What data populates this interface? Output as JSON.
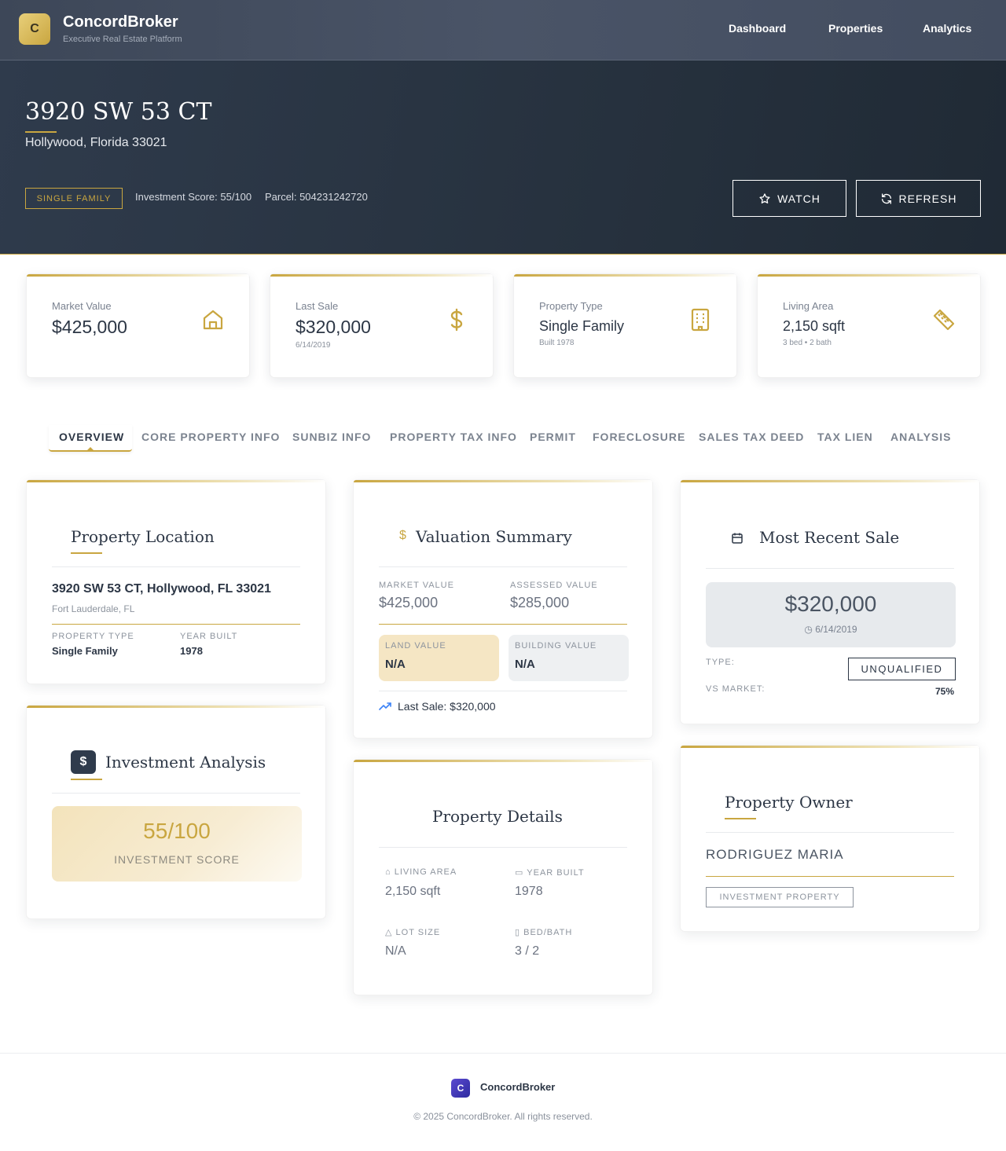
{
  "colors": {
    "accent": "#c9a640",
    "navy": "#2c3645",
    "hero": "#27323f"
  },
  "brand": {
    "logo_letter": "C",
    "name": "ConcordBroker",
    "tagline": "Executive Real Estate Platform"
  },
  "nav": {
    "items": [
      "Dashboard",
      "Properties",
      "Analytics"
    ]
  },
  "hero": {
    "address": "3920 SW 53 CT",
    "city_line": "Hollywood, Florida 33021",
    "badge": "SINGLE FAMILY",
    "investment_score": "Investment Score: 55/100",
    "parcel": "Parcel: 504231242720",
    "watch_label": "WATCH",
    "refresh_label": "REFRESH"
  },
  "stats": [
    {
      "label": "Market Value",
      "value": "$425,000",
      "sub": "",
      "icon": "home-icon"
    },
    {
      "label": "Last Sale",
      "value": "$320,000",
      "sub": "6/14/2019",
      "icon": "dollar-icon"
    },
    {
      "label": "Property Type",
      "value": "Single Family",
      "sub": "Built 1978",
      "icon": "building-icon"
    },
    {
      "label": "Living Area",
      "value": "2,150 sqft",
      "sub": "3 bed • 2 bath",
      "icon": "ruler-icon"
    }
  ],
  "tabs": [
    "OVERVIEW",
    "CORE PROPERTY INFO",
    "SUNBIZ INFO",
    "PROPERTY TAX INFO",
    "PERMIT",
    "FORECLOSURE",
    "SALES TAX DEED",
    "TAX LIEN",
    "ANALYSIS"
  ],
  "location": {
    "title": "Property Location",
    "full_address": "3920 SW 53 CT, Hollywood, FL 33021",
    "area": "Fort Lauderdale, FL",
    "type_label": "PROPERTY TYPE",
    "type_value": "Single Family",
    "year_label": "YEAR BUILT",
    "year_value": "1978"
  },
  "valuation": {
    "title": "Valuation Summary",
    "market_label": "MARKET VALUE",
    "market_value": "$425,000",
    "assessed_label": "ASSESSED VALUE",
    "assessed_value": "$285,000",
    "land_label": "LAND VALUE",
    "land_value": "N/A",
    "building_label": "BUILDING VALUE",
    "building_value": "N/A",
    "last_sale": "Last Sale: $320,000"
  },
  "recent_sale": {
    "title": "Most Recent Sale",
    "price": "$320,000",
    "date": "6/14/2019",
    "type_label": "TYPE:",
    "type_value": "UNQUALIFIED",
    "vs_label": "VS MARKET:",
    "vs_value": "75%"
  },
  "investment": {
    "title": "Investment Analysis",
    "score": "55/100",
    "score_label": "INVESTMENT SCORE"
  },
  "details": {
    "title": "Property Details",
    "living_label": "LIVING AREA",
    "living_value": "2,150 sqft",
    "year_label": "YEAR BUILT",
    "year_value": "1978",
    "lot_label": "LOT SIZE",
    "lot_value": "N/A",
    "bedbath_label": "BED/BATH",
    "bedbath_value": "3 / 2"
  },
  "owner": {
    "title": "Property Owner",
    "name": "RODRIGUEZ MARIA",
    "tag": "INVESTMENT PROPERTY"
  },
  "footer": {
    "logo_letter": "C",
    "name": "ConcordBroker",
    "copyright": "© 2025 ConcordBroker. All rights reserved."
  }
}
